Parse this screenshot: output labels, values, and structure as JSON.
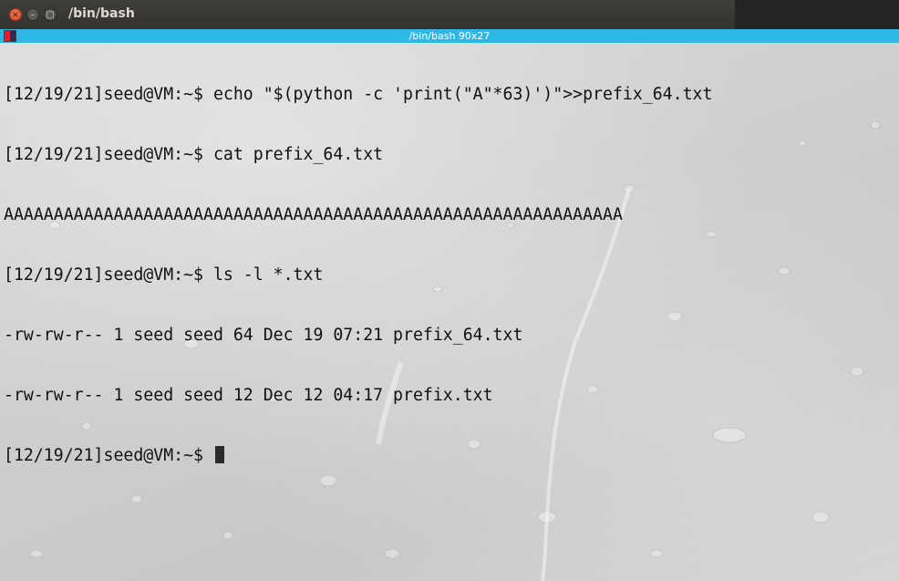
{
  "window": {
    "title": "/bin/bash",
    "close_glyph": "×",
    "min_glyph": "–",
    "max_glyph": "□"
  },
  "tab": {
    "title": "/bin/bash 90x27"
  },
  "terminal": {
    "lines": [
      "[12/19/21]seed@VM:~$ echo \"$(python -c 'print(\"A\"*63)')\">>prefix_64.txt",
      "[12/19/21]seed@VM:~$ cat prefix_64.txt",
      "AAAAAAAAAAAAAAAAAAAAAAAAAAAAAAAAAAAAAAAAAAAAAAAAAAAAAAAAAAAAAA",
      "[12/19/21]seed@VM:~$ ls -l *.txt",
      "-rw-rw-r-- 1 seed seed 64 Dec 19 07:21 prefix_64.txt",
      "-rw-rw-r-- 1 seed seed 12 Dec 12 04:17 prefix.txt",
      "[12/19/21]seed@VM:~$ "
    ]
  },
  "colors": {
    "tab_accent": "#2fb8e6",
    "titlebar": "#3f3e3b",
    "text": "#111111"
  }
}
